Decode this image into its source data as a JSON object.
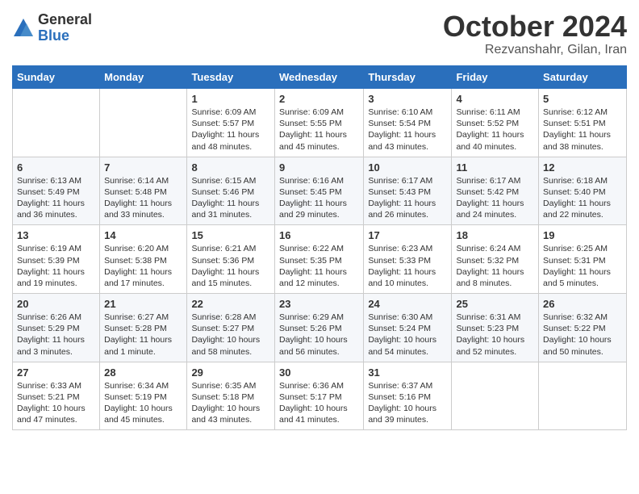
{
  "logo": {
    "general": "General",
    "blue": "Blue"
  },
  "title": "October 2024",
  "subtitle": "Rezvanshahr, Gilan, Iran",
  "headers": [
    "Sunday",
    "Monday",
    "Tuesday",
    "Wednesday",
    "Thursday",
    "Friday",
    "Saturday"
  ],
  "rows": [
    [
      {
        "day": "",
        "sunrise": "",
        "sunset": "",
        "daylight": ""
      },
      {
        "day": "",
        "sunrise": "",
        "sunset": "",
        "daylight": ""
      },
      {
        "day": "1",
        "sunrise": "Sunrise: 6:09 AM",
        "sunset": "Sunset: 5:57 PM",
        "daylight": "Daylight: 11 hours and 48 minutes."
      },
      {
        "day": "2",
        "sunrise": "Sunrise: 6:09 AM",
        "sunset": "Sunset: 5:55 PM",
        "daylight": "Daylight: 11 hours and 45 minutes."
      },
      {
        "day": "3",
        "sunrise": "Sunrise: 6:10 AM",
        "sunset": "Sunset: 5:54 PM",
        "daylight": "Daylight: 11 hours and 43 minutes."
      },
      {
        "day": "4",
        "sunrise": "Sunrise: 6:11 AM",
        "sunset": "Sunset: 5:52 PM",
        "daylight": "Daylight: 11 hours and 40 minutes."
      },
      {
        "day": "5",
        "sunrise": "Sunrise: 6:12 AM",
        "sunset": "Sunset: 5:51 PM",
        "daylight": "Daylight: 11 hours and 38 minutes."
      }
    ],
    [
      {
        "day": "6",
        "sunrise": "Sunrise: 6:13 AM",
        "sunset": "Sunset: 5:49 PM",
        "daylight": "Daylight: 11 hours and 36 minutes."
      },
      {
        "day": "7",
        "sunrise": "Sunrise: 6:14 AM",
        "sunset": "Sunset: 5:48 PM",
        "daylight": "Daylight: 11 hours and 33 minutes."
      },
      {
        "day": "8",
        "sunrise": "Sunrise: 6:15 AM",
        "sunset": "Sunset: 5:46 PM",
        "daylight": "Daylight: 11 hours and 31 minutes."
      },
      {
        "day": "9",
        "sunrise": "Sunrise: 6:16 AM",
        "sunset": "Sunset: 5:45 PM",
        "daylight": "Daylight: 11 hours and 29 minutes."
      },
      {
        "day": "10",
        "sunrise": "Sunrise: 6:17 AM",
        "sunset": "Sunset: 5:43 PM",
        "daylight": "Daylight: 11 hours and 26 minutes."
      },
      {
        "day": "11",
        "sunrise": "Sunrise: 6:17 AM",
        "sunset": "Sunset: 5:42 PM",
        "daylight": "Daylight: 11 hours and 24 minutes."
      },
      {
        "day": "12",
        "sunrise": "Sunrise: 6:18 AM",
        "sunset": "Sunset: 5:40 PM",
        "daylight": "Daylight: 11 hours and 22 minutes."
      }
    ],
    [
      {
        "day": "13",
        "sunrise": "Sunrise: 6:19 AM",
        "sunset": "Sunset: 5:39 PM",
        "daylight": "Daylight: 11 hours and 19 minutes."
      },
      {
        "day": "14",
        "sunrise": "Sunrise: 6:20 AM",
        "sunset": "Sunset: 5:38 PM",
        "daylight": "Daylight: 11 hours and 17 minutes."
      },
      {
        "day": "15",
        "sunrise": "Sunrise: 6:21 AM",
        "sunset": "Sunset: 5:36 PM",
        "daylight": "Daylight: 11 hours and 15 minutes."
      },
      {
        "day": "16",
        "sunrise": "Sunrise: 6:22 AM",
        "sunset": "Sunset: 5:35 PM",
        "daylight": "Daylight: 11 hours and 12 minutes."
      },
      {
        "day": "17",
        "sunrise": "Sunrise: 6:23 AM",
        "sunset": "Sunset: 5:33 PM",
        "daylight": "Daylight: 11 hours and 10 minutes."
      },
      {
        "day": "18",
        "sunrise": "Sunrise: 6:24 AM",
        "sunset": "Sunset: 5:32 PM",
        "daylight": "Daylight: 11 hours and 8 minutes."
      },
      {
        "day": "19",
        "sunrise": "Sunrise: 6:25 AM",
        "sunset": "Sunset: 5:31 PM",
        "daylight": "Daylight: 11 hours and 5 minutes."
      }
    ],
    [
      {
        "day": "20",
        "sunrise": "Sunrise: 6:26 AM",
        "sunset": "Sunset: 5:29 PM",
        "daylight": "Daylight: 11 hours and 3 minutes."
      },
      {
        "day": "21",
        "sunrise": "Sunrise: 6:27 AM",
        "sunset": "Sunset: 5:28 PM",
        "daylight": "Daylight: 11 hours and 1 minute."
      },
      {
        "day": "22",
        "sunrise": "Sunrise: 6:28 AM",
        "sunset": "Sunset: 5:27 PM",
        "daylight": "Daylight: 10 hours and 58 minutes."
      },
      {
        "day": "23",
        "sunrise": "Sunrise: 6:29 AM",
        "sunset": "Sunset: 5:26 PM",
        "daylight": "Daylight: 10 hours and 56 minutes."
      },
      {
        "day": "24",
        "sunrise": "Sunrise: 6:30 AM",
        "sunset": "Sunset: 5:24 PM",
        "daylight": "Daylight: 10 hours and 54 minutes."
      },
      {
        "day": "25",
        "sunrise": "Sunrise: 6:31 AM",
        "sunset": "Sunset: 5:23 PM",
        "daylight": "Daylight: 10 hours and 52 minutes."
      },
      {
        "day": "26",
        "sunrise": "Sunrise: 6:32 AM",
        "sunset": "Sunset: 5:22 PM",
        "daylight": "Daylight: 10 hours and 50 minutes."
      }
    ],
    [
      {
        "day": "27",
        "sunrise": "Sunrise: 6:33 AM",
        "sunset": "Sunset: 5:21 PM",
        "daylight": "Daylight: 10 hours and 47 minutes."
      },
      {
        "day": "28",
        "sunrise": "Sunrise: 6:34 AM",
        "sunset": "Sunset: 5:19 PM",
        "daylight": "Daylight: 10 hours and 45 minutes."
      },
      {
        "day": "29",
        "sunrise": "Sunrise: 6:35 AM",
        "sunset": "Sunset: 5:18 PM",
        "daylight": "Daylight: 10 hours and 43 minutes."
      },
      {
        "day": "30",
        "sunrise": "Sunrise: 6:36 AM",
        "sunset": "Sunset: 5:17 PM",
        "daylight": "Daylight: 10 hours and 41 minutes."
      },
      {
        "day": "31",
        "sunrise": "Sunrise: 6:37 AM",
        "sunset": "Sunset: 5:16 PM",
        "daylight": "Daylight: 10 hours and 39 minutes."
      },
      {
        "day": "",
        "sunrise": "",
        "sunset": "",
        "daylight": ""
      },
      {
        "day": "",
        "sunrise": "",
        "sunset": "",
        "daylight": ""
      }
    ]
  ]
}
